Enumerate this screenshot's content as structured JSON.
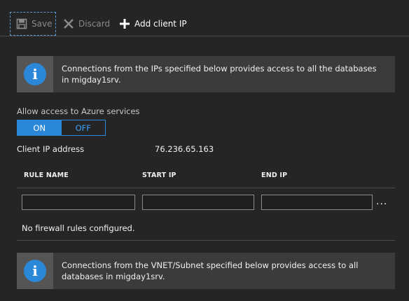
{
  "toolbar": {
    "save_label": "Save",
    "save_icon": "save-disk-icon",
    "discard_label": "Discard",
    "discard_icon": "close-x-icon",
    "add_client_ip_label": "Add client IP",
    "add_icon": "plus-icon"
  },
  "info_banner_1": {
    "icon": "info-icon",
    "text": "Connections from the IPs specified below provides access to all the databases in migday1srv."
  },
  "azure_services": {
    "label": "Allow access to Azure services",
    "on_label": "ON",
    "off_label": "OFF",
    "selected": "ON"
  },
  "client_ip": {
    "label": "Client IP address",
    "value": "76.236.65.163"
  },
  "rules_table": {
    "columns": [
      "RULE NAME",
      "START IP",
      "END IP"
    ],
    "new_row": {
      "rule_name": "",
      "start_ip": "",
      "end_ip": ""
    },
    "more_label": "...",
    "empty_message": "No firewall rules configured."
  },
  "info_banner_2": {
    "icon": "info-icon",
    "text": "Connections from the VNET/Subnet specified below provides access to all databases in migday1srv."
  },
  "colors": {
    "accent": "#2b88d8",
    "background": "#252526",
    "banner": "#3b3b3b"
  }
}
